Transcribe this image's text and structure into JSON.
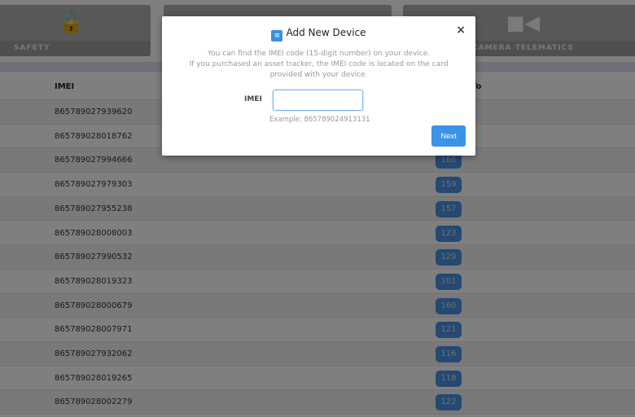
{
  "tiles": [
    {
      "label": "SAFETY",
      "icon": "unlock-icon"
    },
    {
      "label": "",
      "icon": "device-icon"
    },
    {
      "label": "CAMERA TELEMATICS",
      "icon": "video-camera-icon"
    }
  ],
  "table": {
    "headers": {
      "imei": "IMEI",
      "assigned": "To"
    },
    "rows": [
      {
        "imei": "865789027939620",
        "badge": ""
      },
      {
        "imei": "865789028018762",
        "badge": ""
      },
      {
        "imei": "865789027994666",
        "badge": "166"
      },
      {
        "imei": "865789027979303",
        "badge": "159"
      },
      {
        "imei": "865789027955238",
        "badge": "157"
      },
      {
        "imei": "865789028008003",
        "badge": "123"
      },
      {
        "imei": "865789027990532",
        "badge": "129"
      },
      {
        "imei": "865789028019323",
        "badge": "101"
      },
      {
        "imei": "865789028000679",
        "badge": "160"
      },
      {
        "imei": "865789028007971",
        "badge": "121"
      },
      {
        "imei": "865789027932062",
        "badge": "116"
      },
      {
        "imei": "865789028019265",
        "badge": "118"
      },
      {
        "imei": "865789028002279",
        "badge": "122"
      }
    ]
  },
  "modal": {
    "title": "Add New Device",
    "close": "×",
    "desc1": "You can find the IMEI code (15-digit number) on your device.",
    "desc2": "If you purchased an asset tracker, the IMEI code is located on the card provided with your device.",
    "field_label": "IMEI",
    "field_value": "",
    "example": "Example: 865789024913131",
    "next": "Next"
  },
  "colors": {
    "accent": "#3b93e6"
  }
}
